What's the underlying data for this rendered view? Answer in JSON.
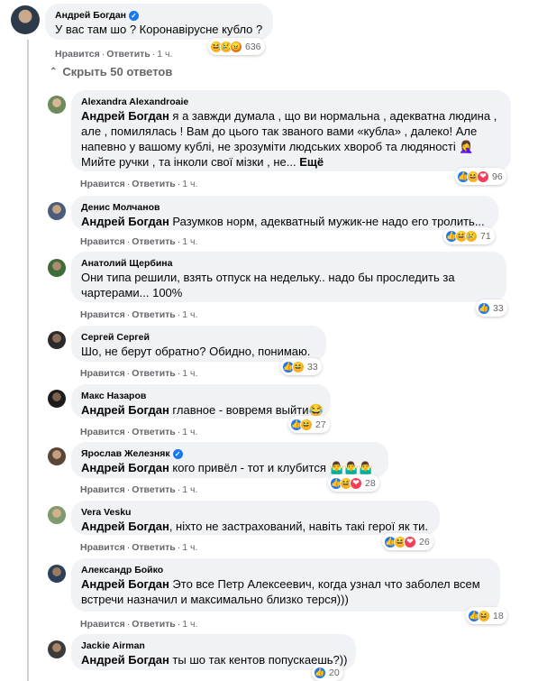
{
  "main_comment": {
    "author": "Андрей Богдан",
    "text": "У вас там шо ? Коронавірусне кубло ?",
    "like": "Нравится",
    "reply": "Ответить",
    "time": "1 ч.",
    "reactions": [
      "haha",
      "sad",
      "angry"
    ],
    "reaction_count": "636"
  },
  "hide_replies_label": "Скрыть 50 ответов",
  "replies": [
    {
      "author": "Alexandra Alexandroaie",
      "mention": "Андрей Богдан",
      "lines": [
        " я а завжди думала , що ви нормальна , адекватна людина ,",
        "але , помилялась ! Вам до цього так званого вами «кубла» , далеко! Але",
        "напевно у вашому кублі, не зрозуміти людських хвороб та людяності 🤦‍♀️",
        "Мийте ручки , та інколи свої мізки , не..."
      ],
      "more": "Ещё",
      "like": "Нравится",
      "reply": "Ответить",
      "time": "1 ч.",
      "reaction_count": "96"
    },
    {
      "author": "Денис Молчанов",
      "mention": "Андрей Богдан",
      "lines": [
        " Разумков норм, адекватный мужик-не надо его тролить..."
      ],
      "like": "Нравится",
      "reply": "Ответить",
      "time": "1 ч.",
      "reaction_count": "71"
    },
    {
      "author": "Анатолий Щербина",
      "lines": [
        "Они типа решили, взять отпуск на недельку.. надо бы проследить за",
        "чартерами... 100%"
      ],
      "like": "Нравится",
      "reply": "Ответить",
      "time": "1 ч.",
      "reaction_count": "33"
    },
    {
      "author": "Сергей Сергей",
      "lines": [
        "Шо, не берут обратно? Обидно, понимаю."
      ],
      "like": "Нравится",
      "reply": "Ответить",
      "time": "1 ч.",
      "reaction_count": "33"
    },
    {
      "author": "Макс Назаров",
      "mention": "Андрей Богдан",
      "lines": [
        " главное - вовремя выйти😂"
      ],
      "like": "Нравится",
      "reply": "Ответить",
      "time": "1 ч.",
      "reaction_count": "27"
    },
    {
      "author": "Ярослав Железняк",
      "mention": "Андрей Богдан",
      "lines": [
        " кого привёл - тот и клубится 🤷‍♂️🤷‍♂️🤷‍♂️"
      ],
      "like": "Нравится",
      "reply": "Ответить",
      "time": "1 ч.",
      "reaction_count": "28"
    },
    {
      "author": "Vera Vesku",
      "mention": "Андрей Богдан",
      "lines": [
        ", ніхто не застрахований, навіть такі герої як ти."
      ],
      "like": "Нравится",
      "reply": "Ответить",
      "time": "1 ч.",
      "reaction_count": "26"
    },
    {
      "author": "Александр Бойко",
      "mention": "Андрей Богдан",
      "lines": [
        " Это все Петр Алексеевич, когда узнал что заболел всем",
        "встречи назначил и максимально близко терся)))"
      ],
      "like": "Нравится",
      "reply": "Ответить",
      "time": "1 ч.",
      "reaction_count": "18"
    },
    {
      "author": "Jackie Airman",
      "mention": "Андрей Богдан",
      "lines": [
        " ты шо так кентов попускаешь?))"
      ],
      "like": "Нравится",
      "reply": "Ответить",
      "time": "1 ч.",
      "reaction_count": "20"
    }
  ]
}
